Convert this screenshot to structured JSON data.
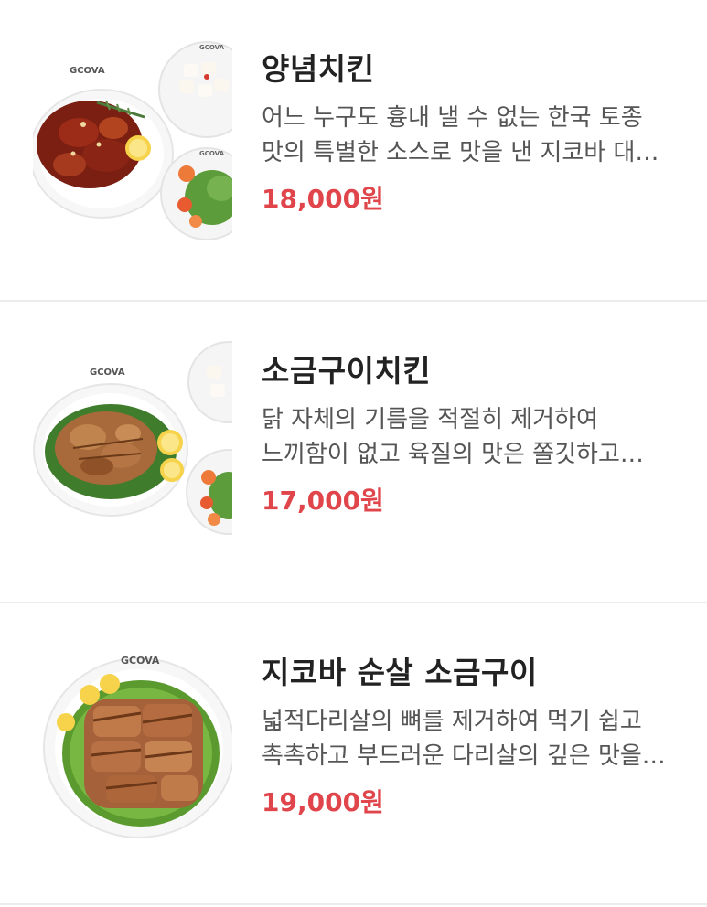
{
  "menu": {
    "items": [
      {
        "title": "양념치킨",
        "description": "어느 누구도 흉내 낼 수 없는 한국 토종 맛의 특별한 소스로 맛을 낸 지코바 대표 메뉴",
        "price": "18,000원",
        "brand": "GCOVA"
      },
      {
        "title": "소금구이치킨",
        "description": "닭 자체의 기름을 적절히 제거하여 느끼함이 없고 육질의 맛은 쫄깃하고 담백한 메뉴",
        "price": "17,000원",
        "brand": "GCOVA"
      },
      {
        "title": "지코바 순살 소금구이",
        "description": "넓적다리살의 뼈를 제거하여 먹기 쉽고 촉촉하고 부드러운 다리살의 깊은 맛을 느낄 수 있는 메뉴",
        "price": "19,000원",
        "brand": "GCOVA"
      }
    ]
  },
  "colors": {
    "price": "#e0454b",
    "title": "#222222",
    "description": "#555555",
    "divider": "#ececec"
  }
}
